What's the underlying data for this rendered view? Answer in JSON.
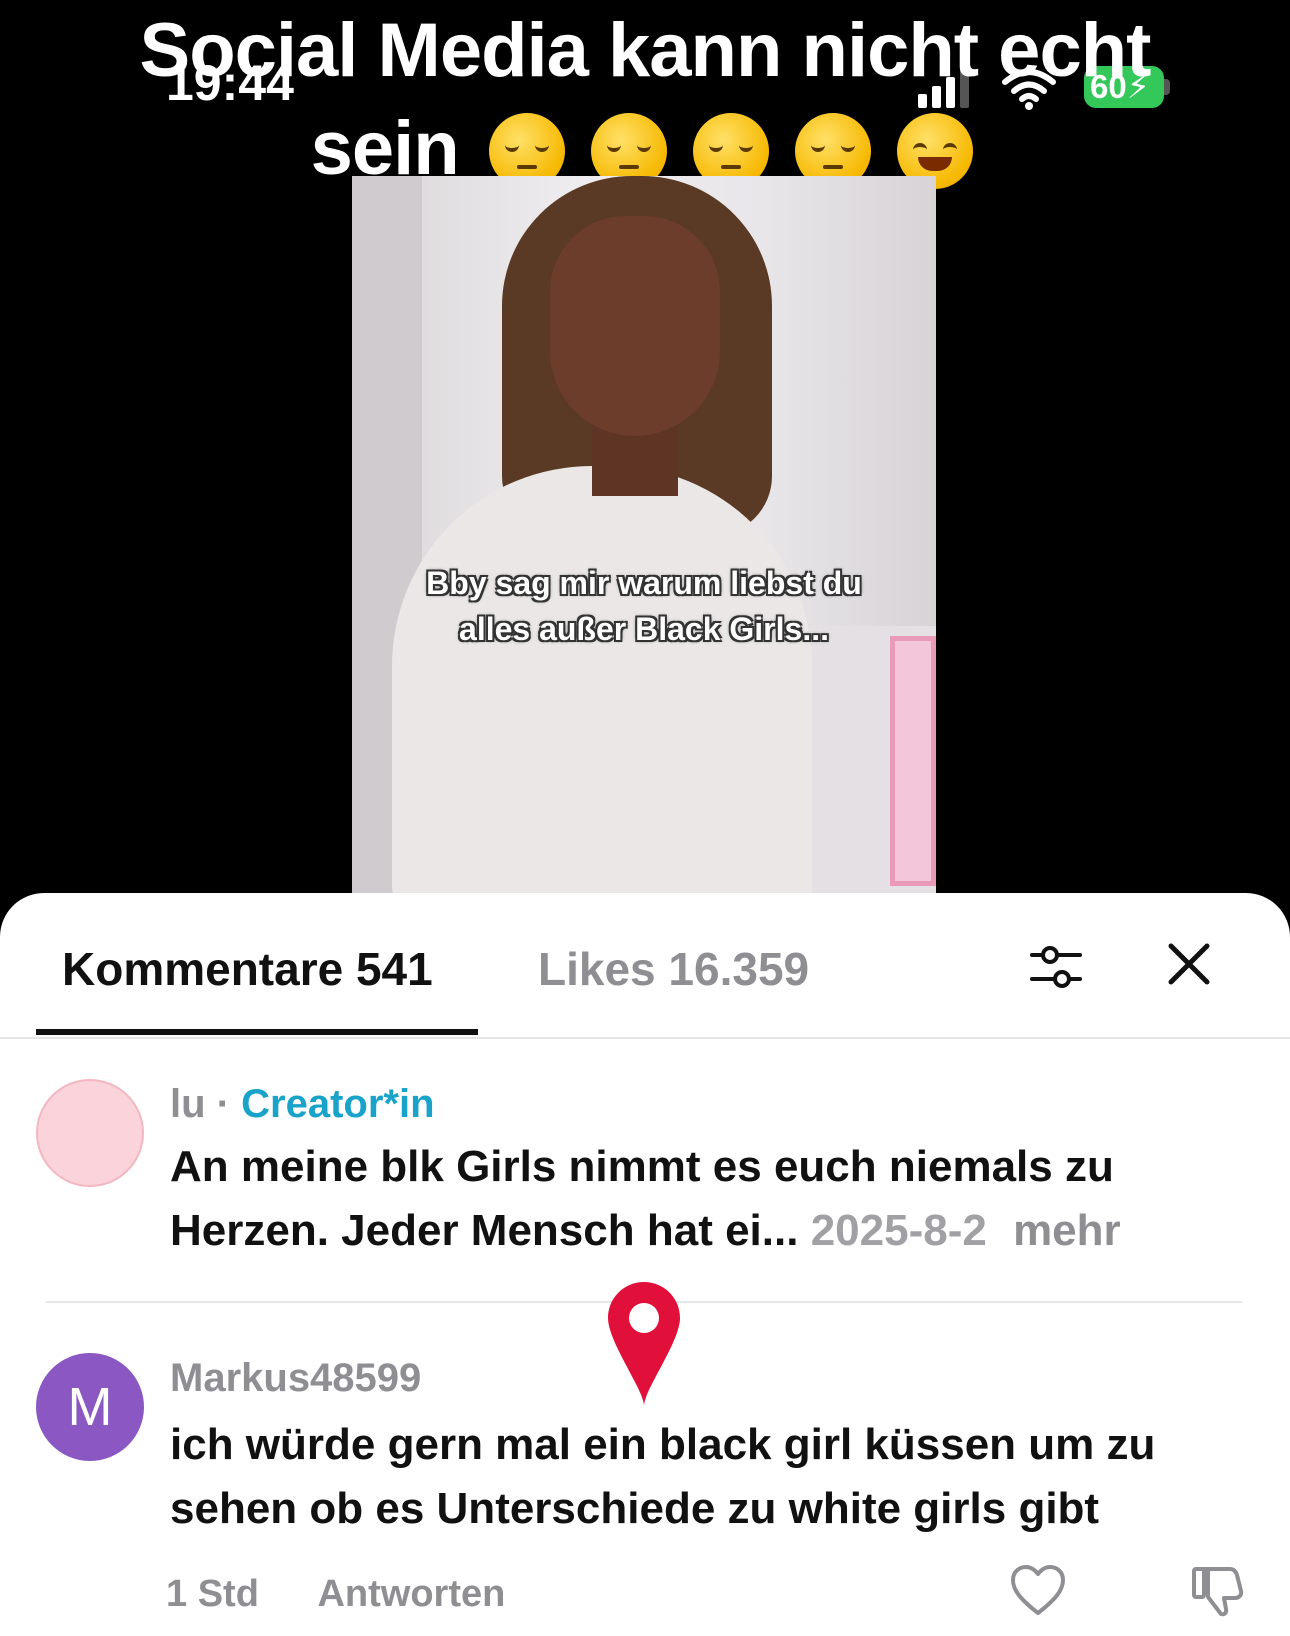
{
  "status_bar": {
    "time": "19:44",
    "battery": "60",
    "icons": [
      "signal-icon",
      "wifi-icon",
      "battery-charging-icon"
    ]
  },
  "overlay": {
    "title_line1": "Social Media kann nicht echt",
    "title_line2": "sein",
    "emojis": [
      "pensive-face-emoji",
      "pensive-face-emoji",
      "pensive-face-emoji",
      "pensive-face-emoji",
      "rolling-laughing-emoji"
    ]
  },
  "video": {
    "caption_line1": "Bby sag mir warum liebst du",
    "caption_line2": "alles außer Black Girls..."
  },
  "sheet": {
    "tab_comments": "Kommentare 541",
    "tab_likes": "Likes 16.359",
    "icons": [
      "filter-icon",
      "close-icon"
    ]
  },
  "comments": [
    {
      "author": "lu",
      "separator": "·",
      "badge": "Creator*in",
      "text": "An meine blk Girls nimmt es euch niemals zu Herzen. Jeder Mensch hat ei...",
      "date": "2025-8-2",
      "more": "mehr",
      "avatar_color": "#fbd3da"
    },
    {
      "author": "Markus48599",
      "avatar_initial": "M",
      "avatar_color": "#8a57c3",
      "text": "ich würde gern mal ein black girl küssen um zu sehen ob es Unterschiede zu white girls gibt",
      "time": "1 Std",
      "reply": "Antworten"
    }
  ],
  "colors": {
    "accent_creator": "#1aa3c9",
    "battery_green": "#34c759",
    "pin_red": "#e0103a"
  }
}
